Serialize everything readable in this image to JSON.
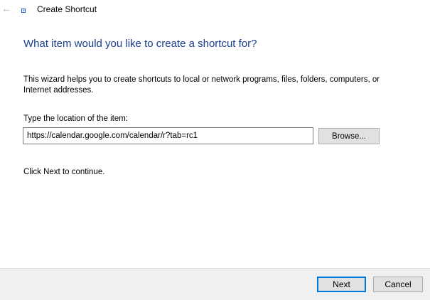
{
  "window": {
    "title": "Create Shortcut",
    "back_glyph": "←",
    "icon": "shortcut-icon"
  },
  "main": {
    "heading": "What item would you like to create a shortcut for?",
    "description": "This wizard helps you to create shortcuts to local or network programs, files, folders, computers, or Internet addresses.",
    "location_label": "Type the location of the item:",
    "location_value": "https://calendar.google.com/calendar/r?tab=rc1",
    "browse_label": "Browse...",
    "continue_text": "Click Next to continue."
  },
  "footer": {
    "next_label": "Next",
    "cancel_label": "Cancel"
  },
  "colors": {
    "heading": "#1a3d8f",
    "accent": "#0078d7",
    "footer_bg": "#f0f0f0",
    "button_bg": "#e1e1e1"
  }
}
